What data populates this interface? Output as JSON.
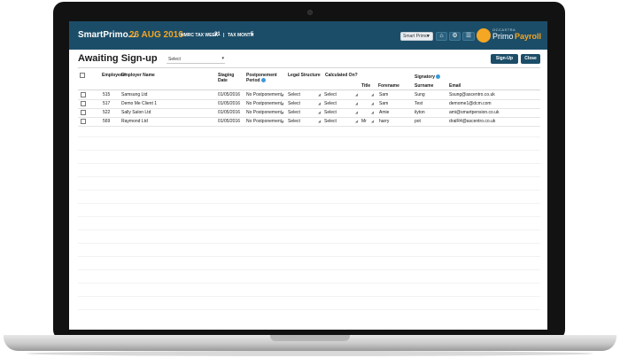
{
  "header": {
    "app_name": "SmartPrimo...",
    "date": "26 AUG 2016",
    "tax_week_label": "HMRC TAX WEEK",
    "tax_week_value": "21",
    "separator": "|",
    "tax_month_label": "TAX MONTH",
    "tax_month_value": "5",
    "user_select": "Smart Primo",
    "brand_small": "OCCASTRA",
    "brand_primo": "Primo",
    "brand_payroll": "Payroll"
  },
  "page": {
    "title": "Awaiting Sign-up",
    "filter": "Select",
    "signup_label": "Sign-Up",
    "close_label": "Close"
  },
  "table": {
    "headers": {
      "employer_num": "Employer #",
      "employer_name": "Employer Name",
      "staging_date": "Staging Date",
      "postponement": "Postponement Period",
      "legal_structure": "Legal Structure",
      "calculated_on": "Calculated On?",
      "signatory": "Signatory",
      "title": "Title",
      "forename": "Forename",
      "surname": "Surname",
      "email": "Email"
    },
    "rows": [
      {
        "num": "515",
        "name": "Samsung Ltd",
        "staging": "01/05/2016",
        "postponement": "No Postponement",
        "legal": "Select",
        "calc": "Select",
        "title": "",
        "forename": "Sam",
        "surname": "Sung",
        "email": "Ssung@ascentro.co.uk"
      },
      {
        "num": "517",
        "name": "Demo Me Client 1",
        "staging": "01/05/2016",
        "postponement": "No Postponement",
        "legal": "Select",
        "calc": "Select",
        "title": "",
        "forename": "Sam",
        "surname": "Test",
        "email": "demome1@dcm.com"
      },
      {
        "num": "522",
        "name": "Sally Salon Ltd",
        "staging": "01/05/2016",
        "postponement": "No Postponement",
        "legal": "Select",
        "calc": "Select",
        "title": "",
        "forename": "Amie",
        "surname": "ilyton",
        "email": "ami@smartpension.co.uk"
      },
      {
        "num": "569",
        "name": "Raymond Ltd",
        "staging": "01/05/2016",
        "postponement": "No Postponement",
        "legal": "Select",
        "calc": "Select",
        "title": "Mr",
        "forename": "harry",
        "surname": "pot",
        "email": "draiR4@ascentro.co.uk"
      }
    ]
  },
  "colors": {
    "header_bg": "#1c4d68",
    "accent_orange": "#f5a623",
    "button_bg": "#1c4d68",
    "info_blue": "#3b9ad9"
  },
  "icons": {
    "home": "home-icon",
    "settings": "gear-icon",
    "menu": "menu-icon",
    "dropdown": "chevron-down-icon",
    "info": "info-icon"
  }
}
